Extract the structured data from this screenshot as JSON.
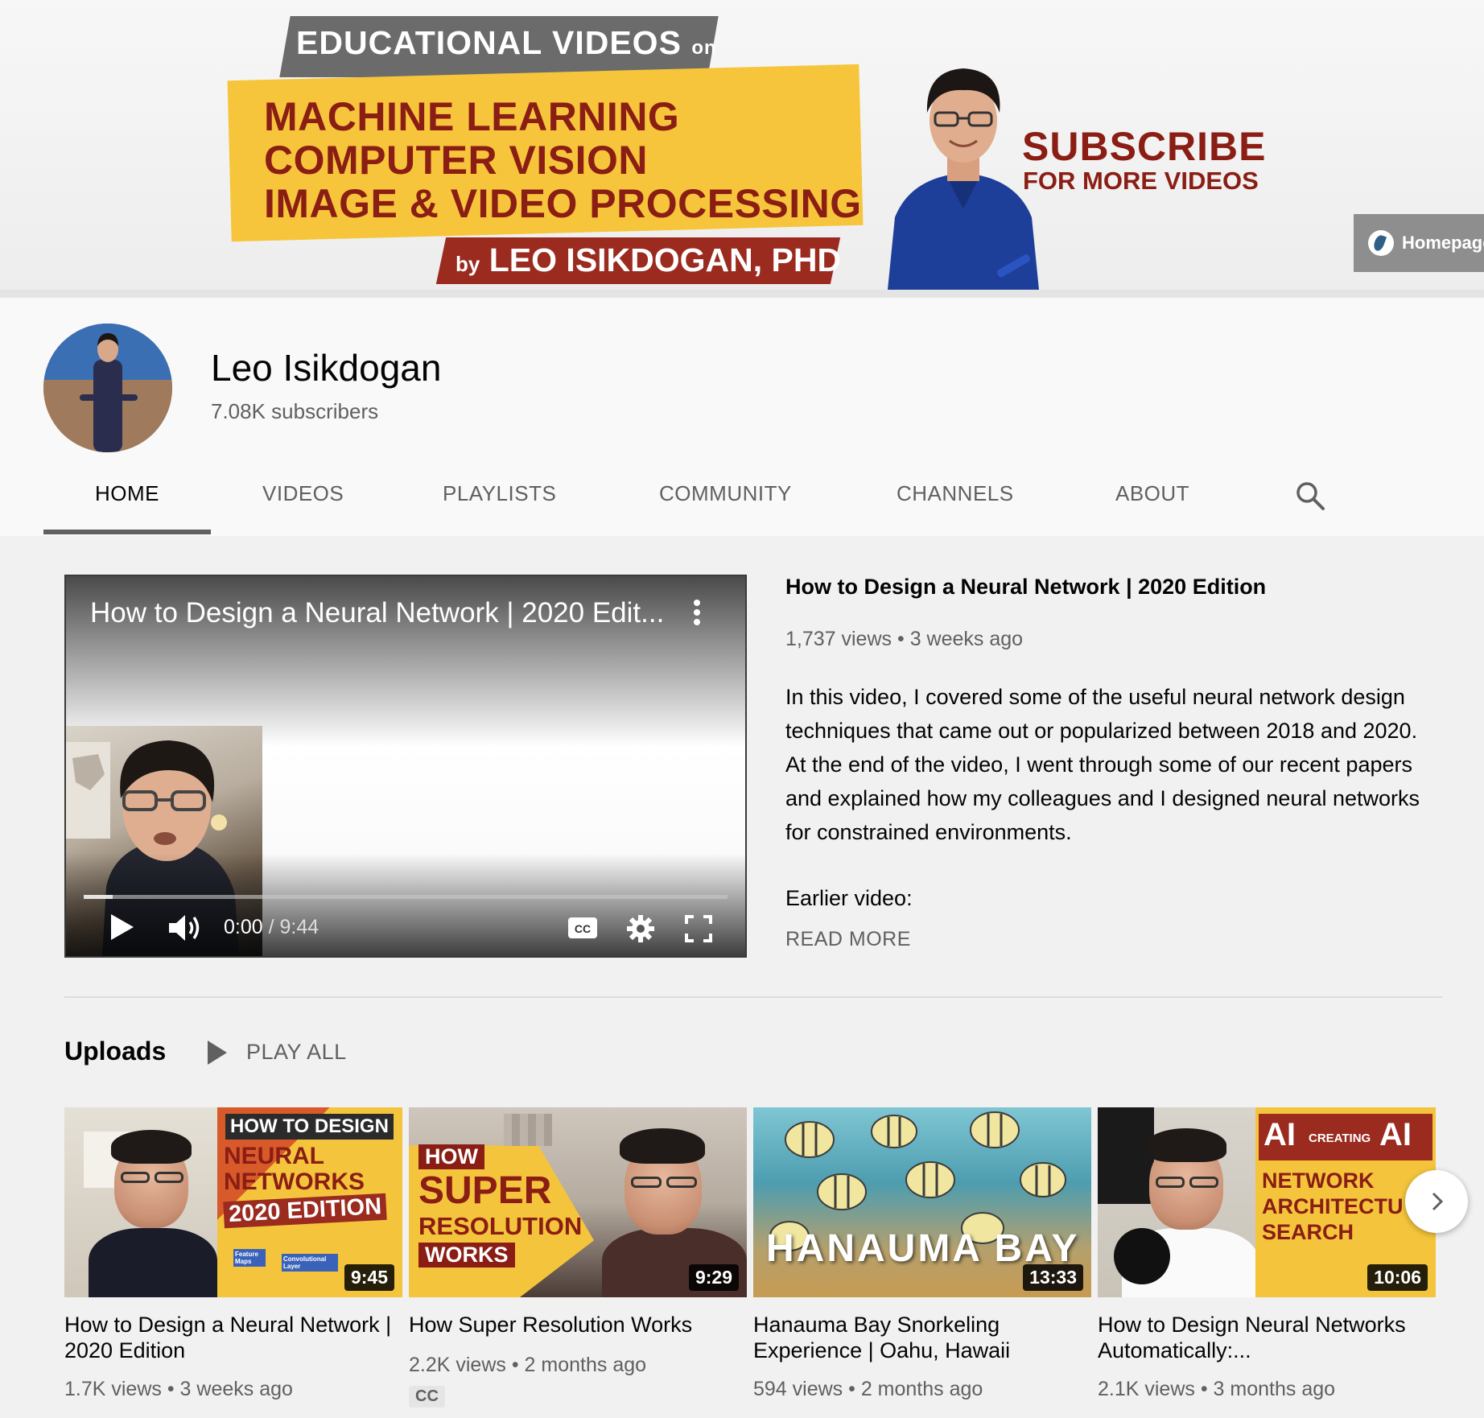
{
  "banner": {
    "edu_line": "EDUCATIONAL VIDEOS",
    "edu_on": "on",
    "topics": [
      "MACHINE LEARNING",
      "COMPUTER VISION",
      "IMAGE & VIDEO PROCESSING"
    ],
    "by": "by",
    "author": "LEO ISIKDOGAN, PHD",
    "subscribe": "SUBSCRIBE",
    "subscribe_sub": "FOR MORE VIDEOS",
    "homepage_link": "Homepage"
  },
  "channel": {
    "name": "Leo Isikdogan",
    "subscribers": "7.08K subscribers"
  },
  "tabs": [
    {
      "label": "HOME",
      "active": true
    },
    {
      "label": "VIDEOS",
      "active": false
    },
    {
      "label": "PLAYLISTS",
      "active": false
    },
    {
      "label": "COMMUNITY",
      "active": false
    },
    {
      "label": "CHANNELS",
      "active": false
    },
    {
      "label": "ABOUT",
      "active": false
    }
  ],
  "featured": {
    "player_title": "How to Design a Neural Network | 2020 Edit...",
    "current_time": "0:00",
    "time_separator": " / ",
    "duration": "9:44",
    "progress": 0.045,
    "title": "How to Design a Neural Network | 2020 Edition",
    "views": "1,737 views",
    "age": "3 weeks ago",
    "description": "In this video, I covered some of the useful neural network design techniques that came out or popularized between 2018 and 2020. At the end of the video, I went through some of our recent papers and explained how my colleagues and I designed neural networks for constrained environments.",
    "earlier": "Earlier video:",
    "read_more": "READ MORE"
  },
  "uploads": {
    "title": "Uploads",
    "play_all": "PLAY ALL",
    "videos": [
      {
        "title": "How to Design a Neural Network | 2020 Edition",
        "views": "1.7K views",
        "age": "3 weeks ago",
        "duration": "9:45",
        "thumb_lines": [
          "HOW TO DESIGN",
          "NEURAL",
          "NETWORKS",
          "2020 EDITION"
        ],
        "thumb_small": [
          "Feature Maps",
          "Convolutional Layer"
        ]
      },
      {
        "title": "How Super Resolution Works",
        "views": "2.2K views",
        "age": "2 months ago",
        "duration": "9:29",
        "badge": "CC",
        "thumb_lines": [
          "HOW",
          "SUPER",
          "RESOLUTION",
          "WORKS"
        ]
      },
      {
        "title": "Hanauma Bay Snorkeling Experience | Oahu, Hawaii",
        "views": "594 views",
        "age": "2 months ago",
        "duration": "13:33",
        "thumb_lines": [
          "HANAUMA BAY"
        ]
      },
      {
        "title": "How to Design Neural Networks Automatically:...",
        "views": "2.1K views",
        "age": "3 months ago",
        "duration": "10:06",
        "thumb_lines": [
          "AI",
          "CREATING",
          "AI",
          "NETWORK",
          "ARCHITECTU",
          "SEARCH"
        ]
      }
    ]
  },
  "colors": {
    "banner_yellow": "#f6c53b",
    "banner_red": "#8a1d14",
    "text_primary": "#030303",
    "text_secondary": "#606060"
  }
}
